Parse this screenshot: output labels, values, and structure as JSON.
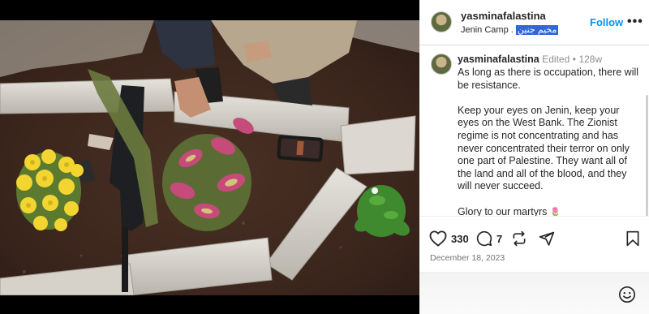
{
  "post": {
    "username": "yasminafalastina",
    "location": {
      "place": "Jenin Camp",
      "separator": ".",
      "arabic": "مخيم جنين"
    },
    "follow_label": "Follow",
    "more_label": "•••",
    "caption_meta": {
      "edited": "Edited",
      "dot": "•",
      "age": "128w"
    },
    "caption": {
      "p1": "As long as there is occupation, there will be resistance.",
      "p2": "Keep your eyes on Jenin, keep your eyes on the West Bank. The Zionist regime is not concentrating and has never concentrated their terror on only one part of Palestine. They want all of the land and all of the blood, and they will never succeed.",
      "p3": "Glory to our martyrs",
      "p3_emoji": "🌷"
    },
    "likes": "330",
    "comments": "7",
    "date": "December 18, 2023"
  },
  "icons": {
    "like": "heart-icon",
    "comment": "comment-bubble-icon",
    "repost": "repost-icon",
    "share": "send-icon",
    "save": "bookmark-icon",
    "emoji": "smiley-icon",
    "more": "more-options-icon"
  },
  "colors": {
    "follow": "#0095f6",
    "text": "#262626",
    "muted": "#8e8e8e",
    "selection": "#3367d6"
  }
}
